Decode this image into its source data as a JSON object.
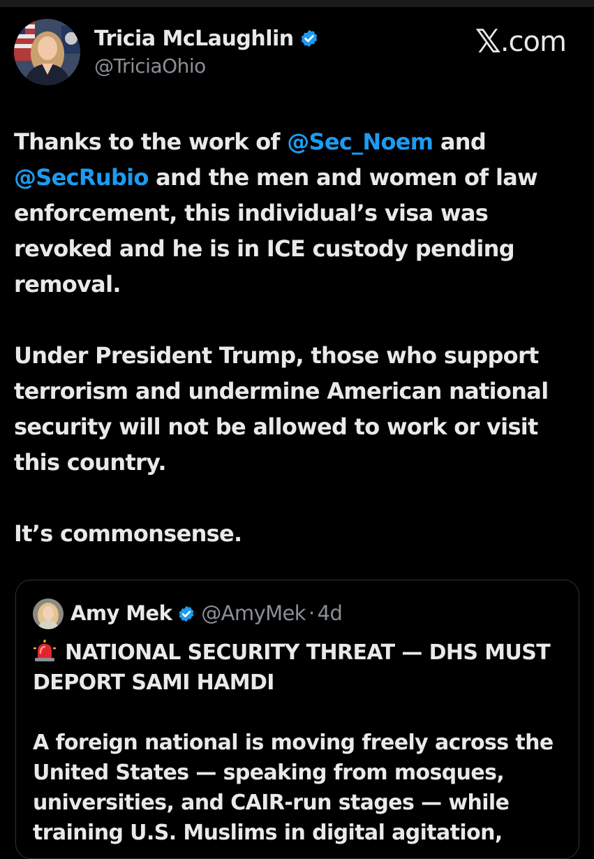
{
  "post": {
    "author": {
      "name": "Tricia McLaughlin",
      "handle": "@TriciaOhio",
      "verified": true
    },
    "brand": {
      "x_mark": "𝕏",
      "domain": ".com"
    },
    "paragraph1": {
      "t1": "Thanks to the work of ",
      "m1": "@Sec_Noem",
      "t2": " and ",
      "m2": "@SecRubio",
      "t3": " and the men and women of law enforcement, this individual’s visa was revoked and he is in ICE custody pending removal."
    },
    "paragraph2": "Under President Trump, those who support terrorism and undermine American national security will not be allowed to work or visit this country.",
    "paragraph3": "It’s commonsense."
  },
  "quote": {
    "author": {
      "name": "Amy Mek",
      "handle": "@AmyMek",
      "separator": "·",
      "time": "4d",
      "verified": true
    },
    "headline_icon": "police-siren-icon",
    "headline": "NATIONAL SECURITY THREAT — DHS MUST DEPORT SAMI HAMDI",
    "body": "A foreign national is moving freely across the United States — speaking from mosques, universities, and CAIR-run stages — while training U.S. Muslims in digital agitation,"
  },
  "colors": {
    "background": "#000000",
    "text": "#e7e9ea",
    "secondary_text": "#8b9096",
    "mention": "#1d9bf0",
    "verified_badge": "#1d9bf0",
    "card_border": "#2f3336"
  }
}
